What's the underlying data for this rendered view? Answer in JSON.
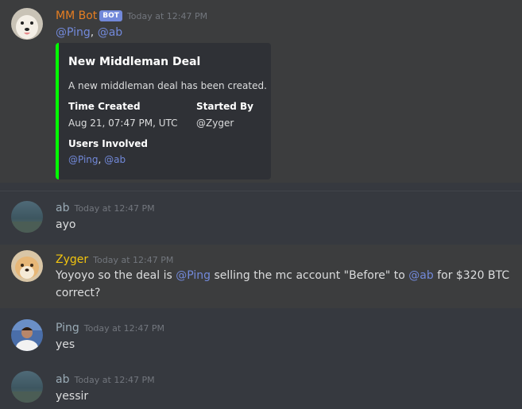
{
  "messages": [
    {
      "username": "MM Bot",
      "bot_tag": "BOT",
      "timestamp": "Today at 12:47 PM",
      "mentions": [
        "@Ping",
        "@ab"
      ],
      "embed": {
        "title": "New Middleman Deal",
        "description": "A new middleman deal has been created.",
        "fields": [
          {
            "name": "Time Created",
            "value": "Aug 21, 07:47 PM, UTC"
          },
          {
            "name": "Started By",
            "value": "@Zyger"
          },
          {
            "name": "Users Involved",
            "value_mentions": [
              "@Ping",
              "@ab"
            ]
          }
        ],
        "color": "#00ff00"
      },
      "name_color": "#e67e22"
    },
    {
      "username": "ab",
      "timestamp": "Today at 12:47 PM",
      "text": "ayo",
      "name_color": "#99aab5"
    },
    {
      "username": "Zyger",
      "timestamp": "Today at 12:47 PM",
      "parts": [
        "Yoyoyo so the deal is ",
        "@Ping",
        " selling the mc account \"Before\" to ",
        "@ab",
        " for $320 BTC"
      ],
      "line2": "correct?",
      "name_color": "#f1c40f"
    },
    {
      "username": "Ping",
      "timestamp": "Today at 12:47 PM",
      "text": "yes",
      "name_color": "#99aab5"
    },
    {
      "username": "ab",
      "timestamp": "Today at 12:47 PM",
      "text": "yessir",
      "name_color": "#99aab5"
    }
  ],
  "colors": {
    "background": "#36393f",
    "mention": "#7289da",
    "embed_bg": "#2f3136"
  }
}
